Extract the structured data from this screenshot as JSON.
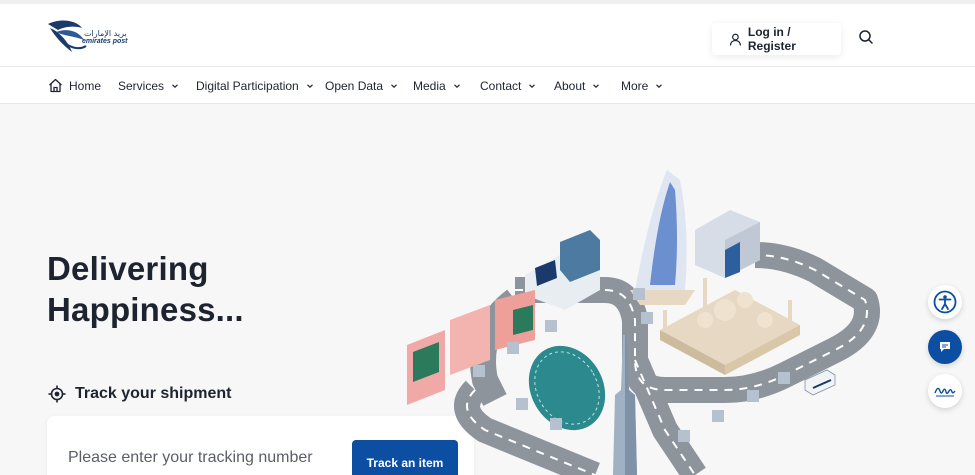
{
  "header": {
    "logo": {
      "text_ar": "بريد الإمارات",
      "text_en": "emirates post",
      "icon": "emirates-post-logo"
    },
    "login_label": "Log in / Register",
    "login_icon": "user-icon",
    "search_icon": "search-icon"
  },
  "nav": {
    "items": [
      {
        "label": "Home",
        "icon": "home-icon"
      },
      {
        "label": "Services"
      },
      {
        "label": "Digital Participation"
      },
      {
        "label": "Open Data"
      },
      {
        "label": "Media"
      },
      {
        "label": "Contact"
      },
      {
        "label": "About"
      },
      {
        "label": "More"
      }
    ]
  },
  "hero": {
    "headline_line1": "Delivering",
    "headline_line2": "Happiness...",
    "track_label": "Track your shipment",
    "track_icon": "location-target-icon",
    "track_placeholder": "Please enter your tracking number",
    "track_button": "Track an item"
  },
  "side_buttons": [
    {
      "icon": "accessibility-icon"
    },
    {
      "icon": "chat-icon"
    },
    {
      "icon": "signature-icon"
    }
  ],
  "colors": {
    "brand_blue": "#0b4ea2",
    "text_dark": "#1d2430",
    "background": "#f7f7f7"
  }
}
